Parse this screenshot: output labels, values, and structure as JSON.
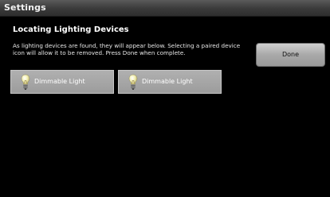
{
  "window": {
    "title": "Settings"
  },
  "main": {
    "heading": "Locating Lighting Devices",
    "instructions": "As lighting devices are found, they will appear below.  Selecting a paired device icon will allow it to be removed.  Press Done when complete.",
    "done_label": "Done"
  },
  "devices": [
    {
      "label": "Dimmable Light",
      "icon": "lightbulb-icon"
    },
    {
      "label": "Dimmable Light",
      "icon": "lightbulb-icon"
    }
  ],
  "colors": {
    "background": "#000000",
    "titlebar": "#3a3a3a",
    "button": "#b3b3b3",
    "device_tile": "#a6a6a6",
    "bulb_glass": "#f3f0b5"
  }
}
